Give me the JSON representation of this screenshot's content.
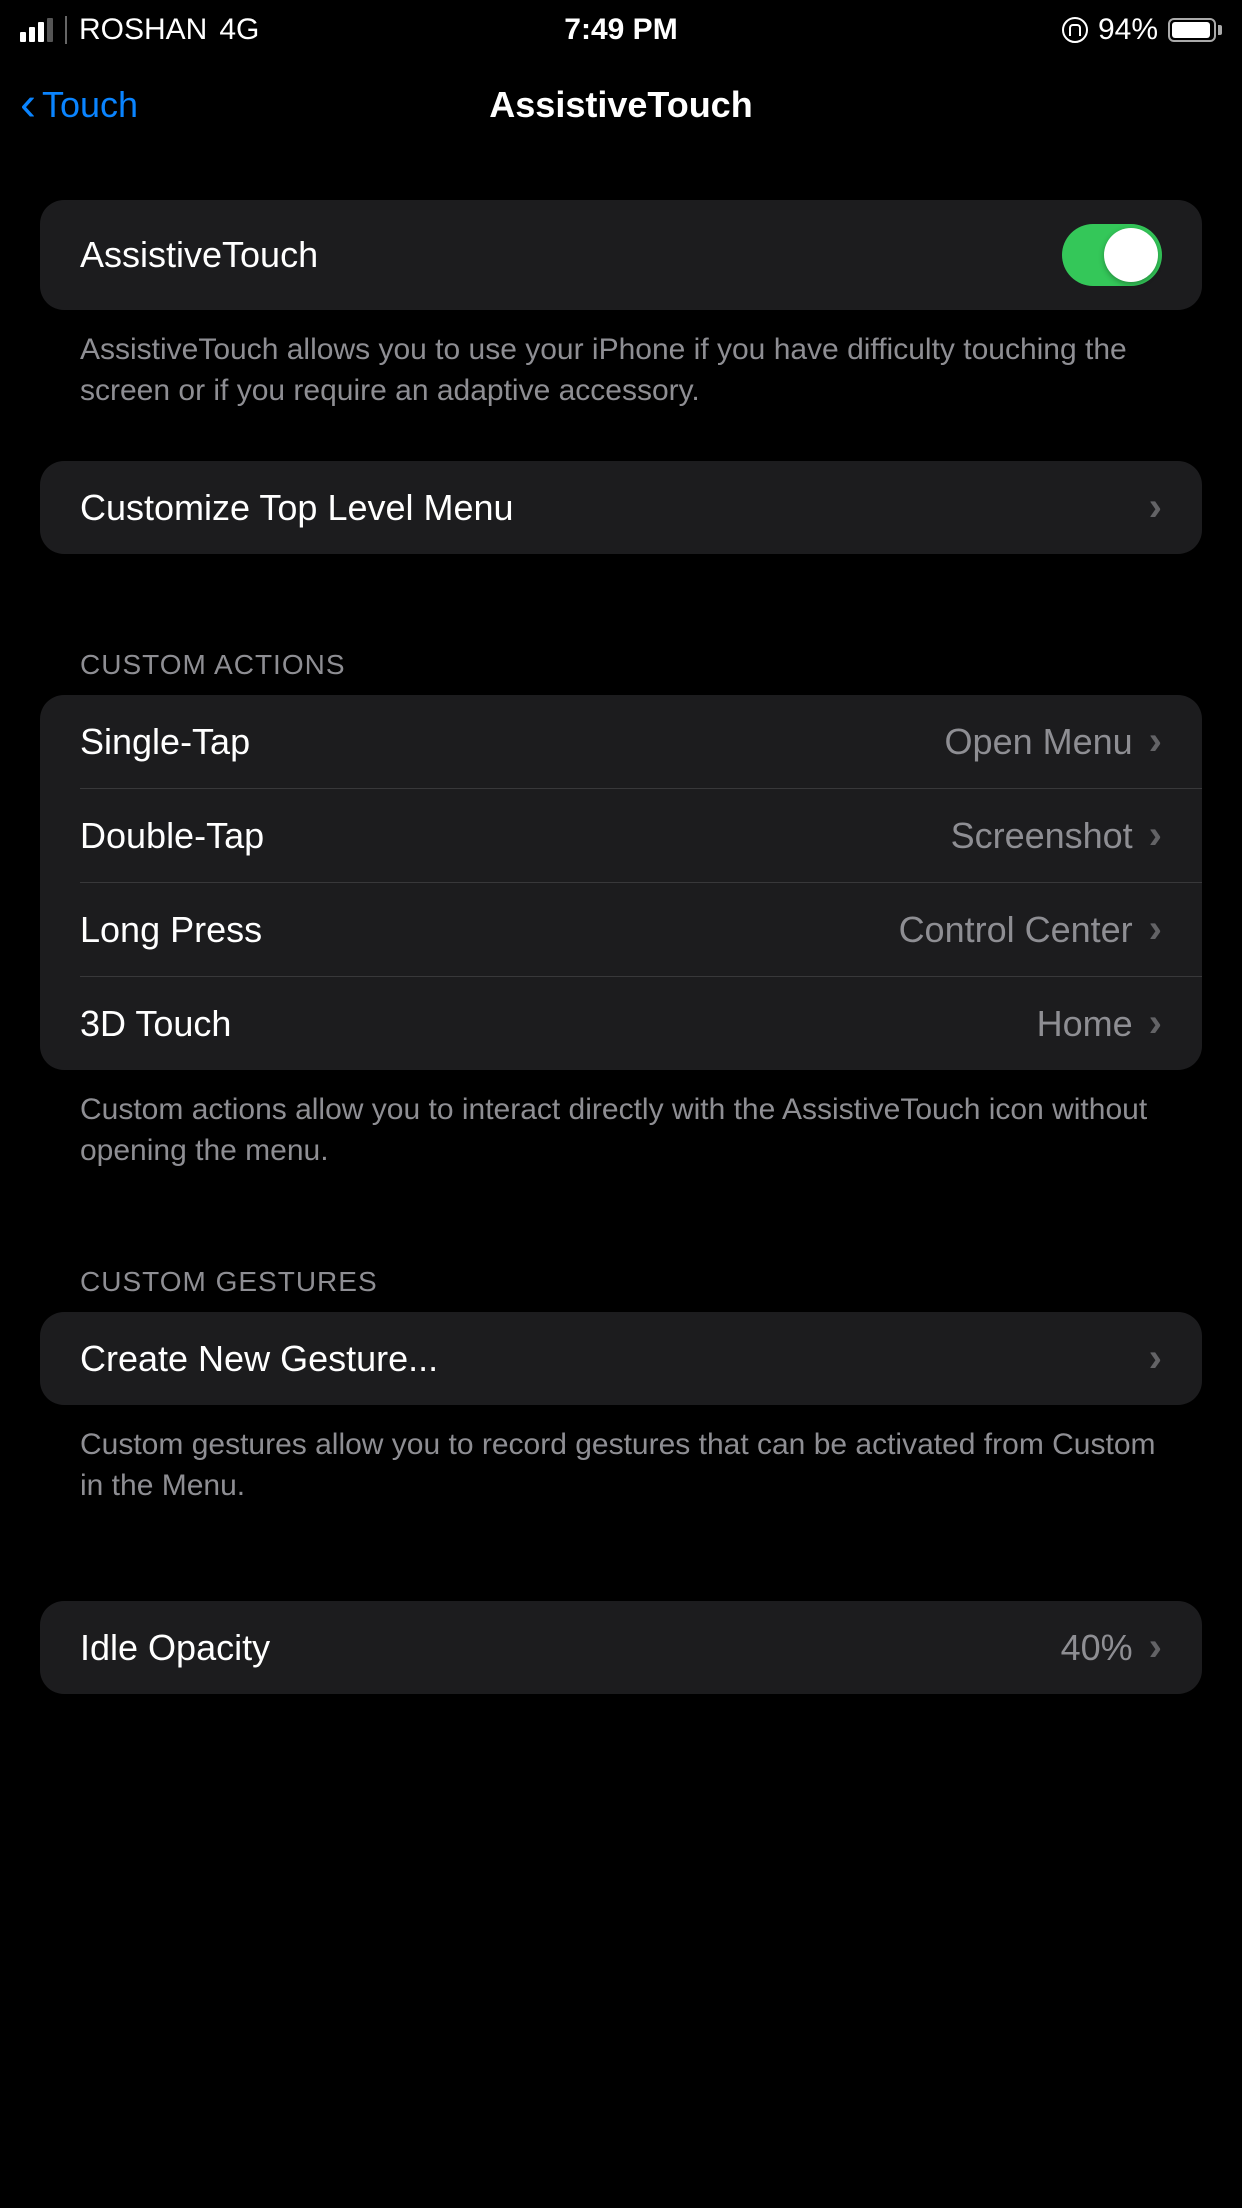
{
  "statusBar": {
    "carrier": "ROSHAN",
    "network": "4G",
    "time": "7:49 PM",
    "batteryPercent": "94%"
  },
  "nav": {
    "backLabel": "Touch",
    "title": "AssistiveTouch"
  },
  "main": {
    "toggleLabel": "AssistiveTouch",
    "toggleOn": true,
    "toggleFooter": "AssistiveTouch allows you to use your iPhone if you have difficulty touching the screen or if you require an adaptive accessory.",
    "customizeLabel": "Customize Top Level Menu"
  },
  "customActions": {
    "header": "CUSTOM ACTIONS",
    "footer": "Custom actions allow you to interact directly with the AssistiveTouch icon without opening the menu.",
    "items": [
      {
        "label": "Single-Tap",
        "value": "Open Menu"
      },
      {
        "label": "Double-Tap",
        "value": "Screenshot"
      },
      {
        "label": "Long Press",
        "value": "Control Center"
      },
      {
        "label": "3D Touch",
        "value": "Home"
      }
    ]
  },
  "customGestures": {
    "header": "CUSTOM GESTURES",
    "createLabel": "Create New Gesture...",
    "footer": "Custom gestures allow you to record gestures that can be activated from Custom in the Menu."
  },
  "idleOpacity": {
    "label": "Idle Opacity",
    "value": "40%"
  }
}
